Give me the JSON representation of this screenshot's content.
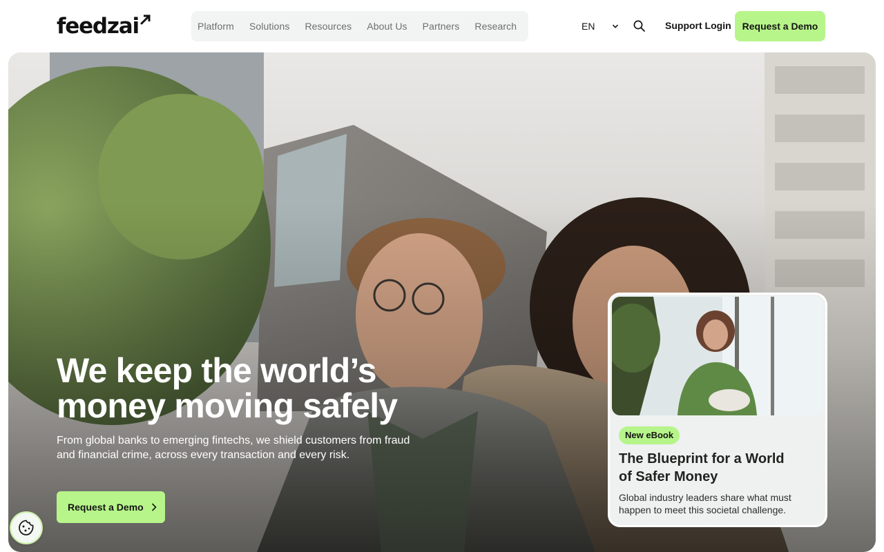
{
  "brand": {
    "name": "feedzai",
    "accent_color": "#b7f58a"
  },
  "nav": {
    "items": [
      "Platform",
      "Solutions",
      "Resources",
      "About Us",
      "Partners",
      "Research"
    ]
  },
  "header": {
    "language": "EN",
    "support_label": "Support Login",
    "demo_label": "Request a Demo",
    "icons": {
      "language": "chevron-down-icon",
      "search": "search-icon"
    }
  },
  "hero": {
    "headline_line1": "We keep the world’s",
    "headline_line2": "money moving safely",
    "subtext_line1": "From global banks to emerging fintechs, we shield customers from fraud",
    "subtext_line2": "and financial crime, across every transaction and every risk.",
    "cta_label": "Request a Demo",
    "cta_icon": "chevron-right-icon"
  },
  "ebook_card": {
    "badge": "New eBook",
    "title_line1": "The Blueprint for a World",
    "title_line2": "of Safer Money",
    "desc_line1": "Global industry leaders share what must",
    "desc_line2": "happen to meet this societal challenge."
  },
  "cookie_button": {
    "icon": "cookie-icon"
  }
}
